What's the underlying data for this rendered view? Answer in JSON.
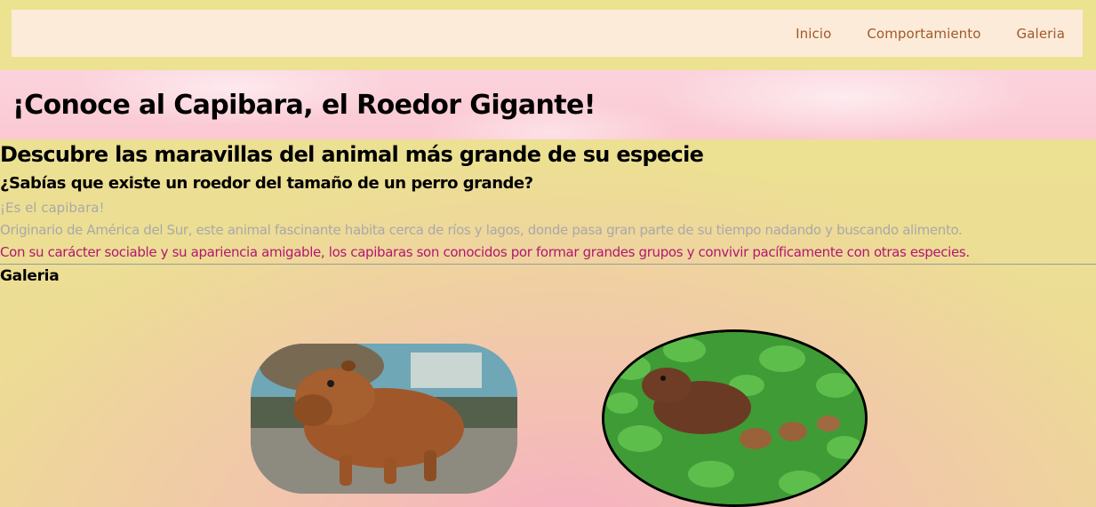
{
  "nav": {
    "items": [
      "Inicio",
      "Comportamiento",
      "Galeria"
    ]
  },
  "hero": {
    "title": "¡Conoce al Capibara, el Roedor Gigante!"
  },
  "main": {
    "subtitle": "Descubre las maravillas del animal más grande de su especie",
    "question": "¿Sabías que existe un roedor del tamaño de un perro grande?",
    "intro": "¡Es el capibara!",
    "paragraph1": "Originario de América del Sur, este animal fascinante habita cerca de ríos y lagos, donde pasa gran parte de su tiempo nadando y buscando alimento.",
    "paragraph2": "Con su carácter sociable y su apariencia amigable, los capibaras son conocidos por formar grandes grupos y convivir pacíficamente con otras especies."
  },
  "gallery": {
    "title": "Galeria"
  },
  "colors": {
    "nav_link": "#a0592a",
    "highlight_text": "#b3176e",
    "muted_text": "#a9a9a9"
  }
}
